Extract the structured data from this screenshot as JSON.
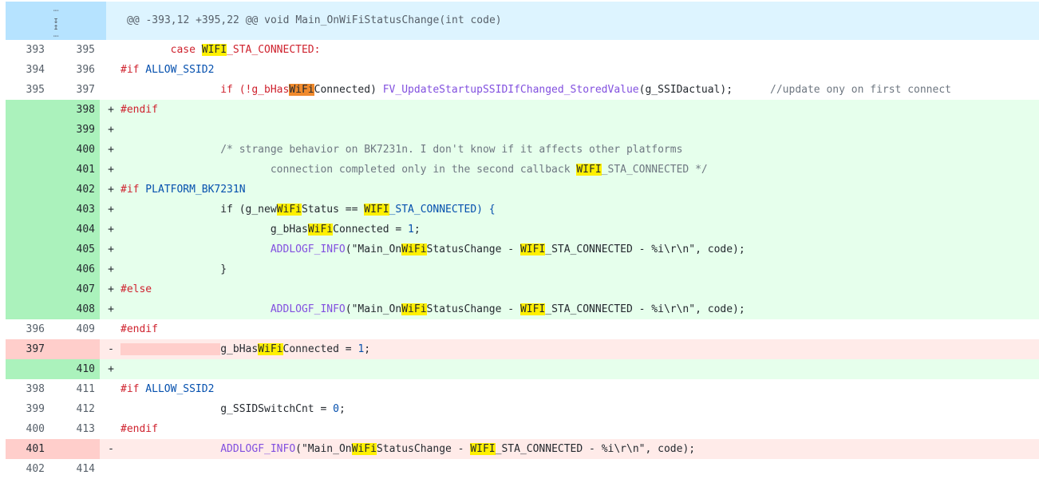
{
  "hunk": {
    "header": "@@ -393,12 +395,22 @@ void Main_OnWiFiStatusChange(int code)",
    "expand_down_icon": "expand-down-icon",
    "expand_up_icon": "expand-up-icon"
  },
  "lines": [
    {
      "type": "ctx",
      "old": "393",
      "new": "395",
      "marker": ""
    },
    {
      "type": "ctx",
      "old": "394",
      "new": "396",
      "marker": ""
    },
    {
      "type": "ctx",
      "old": "395",
      "new": "397",
      "marker": ""
    },
    {
      "type": "add",
      "old": "",
      "new": "398",
      "marker": "+"
    },
    {
      "type": "add",
      "old": "",
      "new": "399",
      "marker": "+"
    },
    {
      "type": "add",
      "old": "",
      "new": "400",
      "marker": "+"
    },
    {
      "type": "add",
      "old": "",
      "new": "401",
      "marker": "+"
    },
    {
      "type": "add",
      "old": "",
      "new": "402",
      "marker": "+"
    },
    {
      "type": "add",
      "old": "",
      "new": "403",
      "marker": "+"
    },
    {
      "type": "add",
      "old": "",
      "new": "404",
      "marker": "+"
    },
    {
      "type": "add",
      "old": "",
      "new": "405",
      "marker": "+"
    },
    {
      "type": "add",
      "old": "",
      "new": "406",
      "marker": "+"
    },
    {
      "type": "add",
      "old": "",
      "new": "407",
      "marker": "+"
    },
    {
      "type": "add",
      "old": "",
      "new": "408",
      "marker": "+"
    },
    {
      "type": "ctx",
      "old": "396",
      "new": "409",
      "marker": ""
    },
    {
      "type": "del",
      "old": "397",
      "new": "",
      "marker": "-"
    },
    {
      "type": "add",
      "old": "",
      "new": "410",
      "marker": "+"
    },
    {
      "type": "ctx",
      "old": "398",
      "new": "411",
      "marker": ""
    },
    {
      "type": "ctx",
      "old": "399",
      "new": "412",
      "marker": ""
    },
    {
      "type": "ctx",
      "old": "400",
      "new": "413",
      "marker": ""
    },
    {
      "type": "del",
      "old": "401",
      "new": "",
      "marker": "-"
    },
    {
      "type": "ctx",
      "old": "402",
      "new": "414",
      "marker": ""
    }
  ],
  "code": {
    "l393_a": "        case ",
    "l393_hl": "WIFI",
    "l393_b": "_STA_CONNECTED:",
    "l394_a": "#if",
    "l394_b": " ALLOW_SSID2",
    "l395_a": "                if (!g_bHas",
    "l395_hl": "WiFi",
    "l395_b": "Connected) ",
    "l395_fn": "FV_UpdateStartupSSIDIfChanged_StoredValue",
    "l395_c": "(g_SSIDactual);      ",
    "l395_cm": "//update ony on first connect",
    "l398": "#endif",
    "l399": "",
    "l400": "                /* strange behavior on BK7231n. I don't know if it affects other platforms",
    "l401_a": "                        connection completed only in the second callback ",
    "l401_hl": "WIFI",
    "l401_b": "_STA_CONNECTED */",
    "l402_a": "#if",
    "l402_b": " PLATFORM_BK7231N",
    "l403_a": "                if (g_new",
    "l403_hl1": "WiFi",
    "l403_b": "Status == ",
    "l403_hl2": "WIFI",
    "l403_c": "_STA_CONNECTED) {",
    "l404_a": "                        g_bHas",
    "l404_hl": "WiFi",
    "l404_b": "Connected = ",
    "l404_num": "1",
    "l404_c": ";",
    "l405_pre": "                        ",
    "l405_fn": "ADDLOGF_INFO",
    "l405_a": "(\"Main_On",
    "l405_hl1": "WiFi",
    "l405_b": "StatusChange - ",
    "l405_hl2": "WIFI",
    "l405_c": "_STA_CONNECTED - %i\\r\\n\", code);",
    "l406": "                }",
    "l407": "#else",
    "l409": "#endif",
    "l397_pre": "                ",
    "l397_a": "g_bHas",
    "l397_hl": "WiFi",
    "l397_b": "Connected = ",
    "l397_num": "1",
    "l397_c": ";",
    "l410": "",
    "l411_a": "#if",
    "l411_b": " ALLOW_SSID2",
    "l412_a": "                g_SSIDSwitchCnt = ",
    "l412_num": "0",
    "l412_b": ";",
    "l413": "#endif",
    "l401d_pre": "                ",
    "l401d_fn": "ADDLOGF_INFO",
    "l401d_a": "(\"Main_On",
    "l401d_hl1": "WiFi",
    "l401d_b": "StatusChange - ",
    "l401d_hl2": "WIFI",
    "l401d_c": "_STA_CONNECTED - %i\\r\\n\", code);"
  }
}
